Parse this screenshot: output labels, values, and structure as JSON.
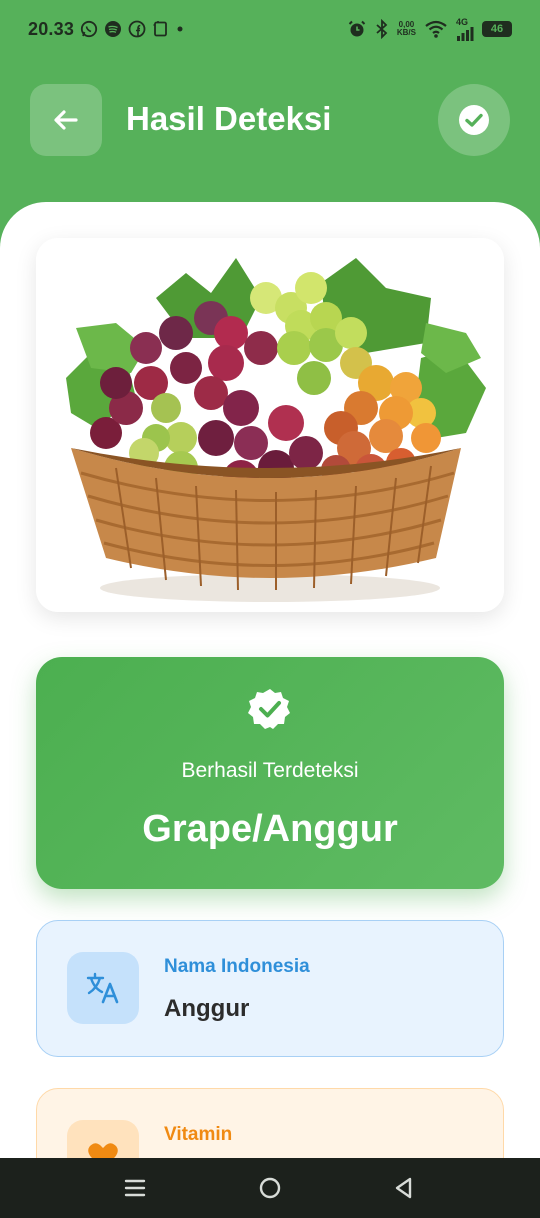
{
  "status_bar": {
    "time": "20.33",
    "net_speed_value": "0,00",
    "net_speed_unit": "KB/S",
    "network_type": "4G",
    "battery": "46",
    "left_icons": [
      "whatsapp-icon",
      "spotify-icon",
      "facebook-icon",
      "screenshot-icon",
      "dot-icon"
    ],
    "right_icons": [
      "alarm-icon",
      "bluetooth-icon",
      "wifi-icon",
      "signal-icon",
      "battery-icon"
    ]
  },
  "app_bar": {
    "title": "Hasil Deteksi",
    "back_icon": "arrow-left-icon",
    "action_icon": "check-circle-icon"
  },
  "detection": {
    "status_label": "Berhasil Terdeteksi",
    "result_name": "Grape/Anggur",
    "icon": "verified-badge-icon"
  },
  "info_cards": [
    {
      "label": "Nama Indonesia",
      "value": "Anggur",
      "icon": "translate-icon",
      "color": "#2f8fd9"
    },
    {
      "label": "Vitamin",
      "value": "",
      "icon": "heart-icon",
      "color": "#f08a12"
    }
  ],
  "nav_bar": {
    "icons": [
      "menu-icon",
      "home-circle-icon",
      "back-triangle-icon"
    ]
  },
  "colors": {
    "primary": "#4caf50",
    "header_bg": "#56b15a",
    "info_blue": "#2f8fd9",
    "info_orange": "#f08a12"
  }
}
